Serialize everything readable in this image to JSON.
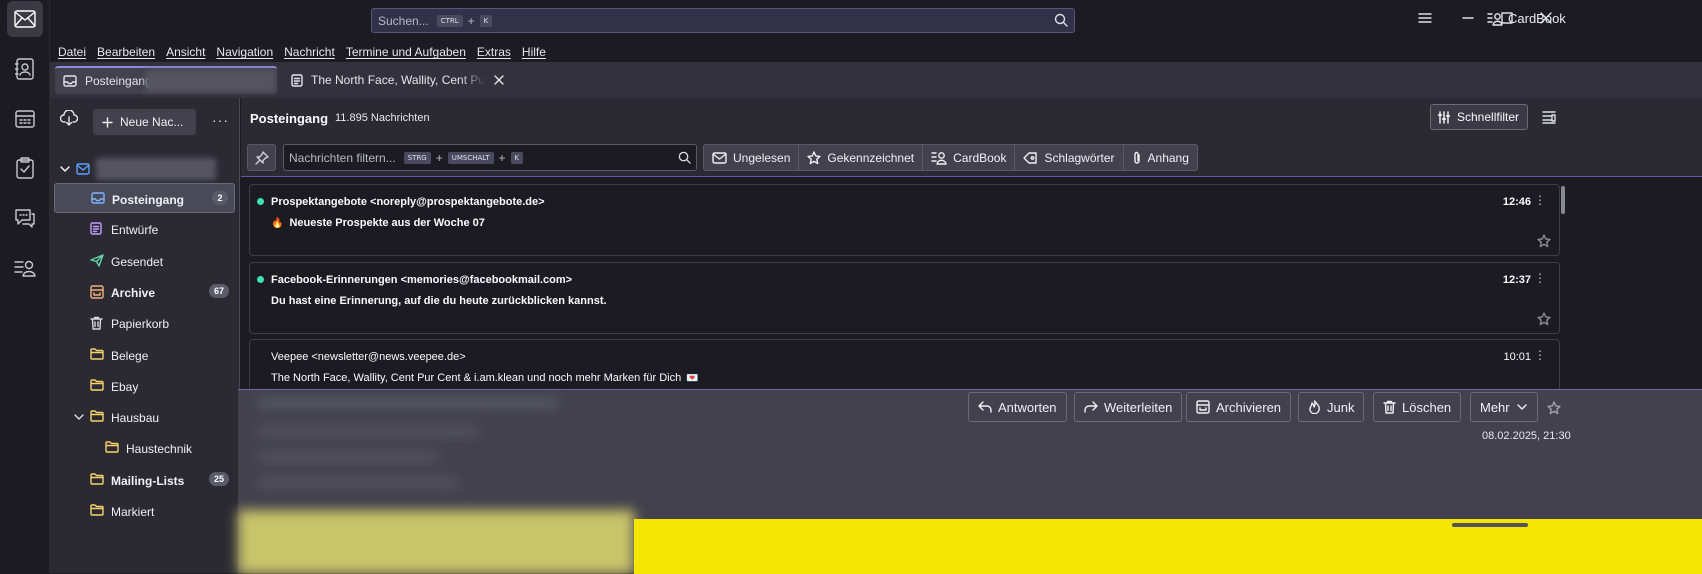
{
  "app": {
    "name": "Thunderbird"
  },
  "spaces": [
    {
      "name": "mail-icon",
      "active": true
    },
    {
      "name": "address-book-icon",
      "active": false
    },
    {
      "name": "calendar-icon",
      "active": false
    },
    {
      "name": "tasks-icon",
      "active": false
    },
    {
      "name": "chat-icon",
      "active": false
    },
    {
      "name": "cardbook-icon",
      "active": false
    }
  ],
  "search": {
    "placeholder": "Suchen...",
    "shortcut_mod": "CTRL",
    "plus": "+",
    "shortcut_key": "K"
  },
  "titlebar": {
    "cardbook_label": "CardBook"
  },
  "menubar": [
    "Datei",
    "Bearbeiten",
    "Ansicht",
    "Navigation",
    "Nachricht",
    "Termine und Aufgaben",
    "Extras",
    "Hilfe"
  ],
  "tabs": [
    {
      "label": "Posteingang",
      "active": true
    },
    {
      "label": "The North Face, Wallity, Cent Pur Ce",
      "active": false
    }
  ],
  "folderpane": {
    "new_message_label": "Neue Nac...",
    "folders": [
      {
        "label": "Posteingang",
        "icon": "inbox-icon",
        "badge": "2",
        "selected": true,
        "bold": true,
        "indent": 0
      },
      {
        "label": "Entwürfe",
        "icon": "drafts-icon",
        "badge": "",
        "selected": false,
        "bold": false,
        "indent": 0
      },
      {
        "label": "Gesendet",
        "icon": "sent-icon",
        "badge": "",
        "selected": false,
        "bold": false,
        "indent": 0
      },
      {
        "label": "Archive",
        "icon": "archive-icon",
        "badge": "67",
        "selected": false,
        "bold": true,
        "indent": 0
      },
      {
        "label": "Papierkorb",
        "icon": "trash-icon",
        "badge": "",
        "selected": false,
        "bold": false,
        "indent": 0
      },
      {
        "label": "Belege",
        "icon": "folder-icon",
        "badge": "",
        "selected": false,
        "bold": false,
        "indent": 0
      },
      {
        "label": "Ebay",
        "icon": "folder-icon",
        "badge": "",
        "selected": false,
        "bold": false,
        "indent": 0
      },
      {
        "label": "Hausbau",
        "icon": "folder-icon",
        "badge": "",
        "selected": false,
        "bold": false,
        "indent": 0,
        "expanded": true
      },
      {
        "label": "Haustechnik",
        "icon": "folder-icon",
        "badge": "",
        "selected": false,
        "bold": false,
        "indent": 1
      },
      {
        "label": "Mailing-Lists",
        "icon": "folder-icon",
        "badge": "25",
        "selected": false,
        "bold": true,
        "indent": 0
      },
      {
        "label": "Markiert",
        "icon": "folder-icon",
        "badge": "",
        "selected": false,
        "bold": false,
        "indent": 0
      }
    ]
  },
  "threadpane": {
    "title": "Posteingang",
    "count": "11.895 Nachrichten",
    "quickfilter_label": "Schnellfilter",
    "filter_placeholder": "Nachrichten filtern...",
    "filter_mod1": "STRG",
    "filter_mod2": "UMSCHALT",
    "filter_key": "K",
    "plus": "+",
    "filter_buttons": [
      {
        "label": "Ungelesen",
        "icon": "unread-icon"
      },
      {
        "label": "Gekennzeichnet",
        "icon": "star-icon"
      },
      {
        "label": "CardBook",
        "icon": "contact-icon"
      },
      {
        "label": "Schlagwörter",
        "icon": "tag-icon"
      },
      {
        "label": "Anhang",
        "icon": "attachment-icon"
      }
    ],
    "messages": [
      {
        "from": "Prospektangebote <noreply@prospektangebote.de>",
        "subject": "Neueste Prospekte aus der Woche 07",
        "subject_emoji": "🔥",
        "time": "12:46",
        "unread": true
      },
      {
        "from": "Facebook-Erinnerungen <memories@facebookmail.com>",
        "subject": "Du hast eine Erinnerung, auf die du heute zurückblicken kannst.",
        "subject_emoji": "",
        "time": "12:37",
        "unread": true
      },
      {
        "from": "Veepee <newsletter@news.veepee.de>",
        "subject": "The North Face, Wallity, Cent Pur Cent & i.am.klean und noch mehr Marken für Dich",
        "subject_emoji": "💌",
        "time": "10:01",
        "unread": false
      }
    ]
  },
  "messageheader": {
    "buttons": [
      {
        "label": "Antworten",
        "icon": "reply-icon"
      },
      {
        "label": "Weiterleiten",
        "icon": "forward-icon"
      },
      {
        "label": "Archivieren",
        "icon": "archive-icon"
      },
      {
        "label": "Junk",
        "icon": "junk-icon"
      },
      {
        "label": "Löschen",
        "icon": "trash-icon"
      },
      {
        "label": "Mehr",
        "icon": "chevron-down-icon"
      }
    ],
    "date": "08.02.2025, 21:30",
    "banner_color": "#f5e600"
  }
}
